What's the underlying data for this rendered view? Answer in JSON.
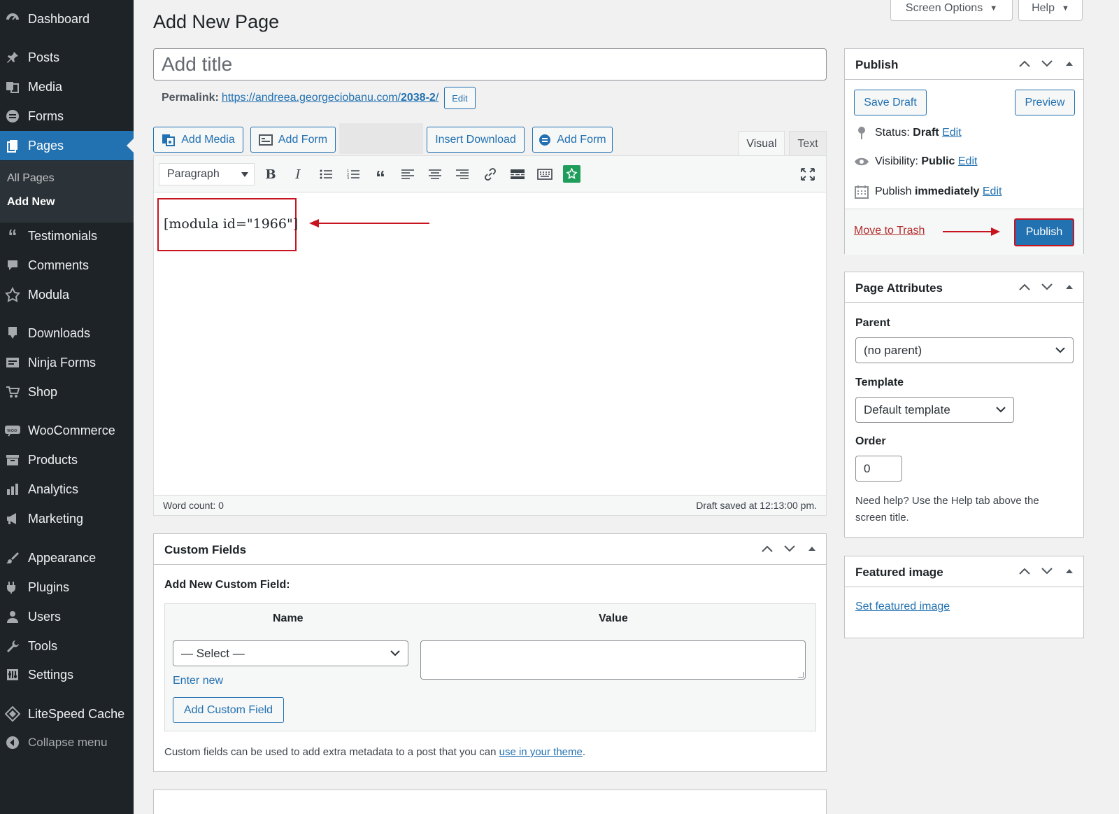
{
  "sidebar": {
    "items": [
      {
        "label": "Dashboard",
        "icon": "dashboard-icon"
      },
      {
        "label": "Posts",
        "icon": "pin-icon"
      },
      {
        "label": "Media",
        "icon": "media-icon"
      },
      {
        "label": "Forms",
        "icon": "forms-icon"
      },
      {
        "label": "Pages",
        "icon": "pages-icon"
      },
      {
        "label": "Testimonials",
        "icon": "quote-icon"
      },
      {
        "label": "Comments",
        "icon": "comment-icon"
      },
      {
        "label": "Modula",
        "icon": "modula-icon"
      },
      {
        "label": "Downloads",
        "icon": "download-icon"
      },
      {
        "label": "Ninja Forms",
        "icon": "ninja-forms-icon"
      },
      {
        "label": "Shop",
        "icon": "cart-icon"
      },
      {
        "label": "WooCommerce",
        "icon": "woo-icon"
      },
      {
        "label": "Products",
        "icon": "archive-icon"
      },
      {
        "label": "Analytics",
        "icon": "bar-chart-icon"
      },
      {
        "label": "Marketing",
        "icon": "megaphone-icon"
      },
      {
        "label": "Appearance",
        "icon": "brush-icon"
      },
      {
        "label": "Plugins",
        "icon": "plug-icon"
      },
      {
        "label": "Users",
        "icon": "user-icon"
      },
      {
        "label": "Tools",
        "icon": "wrench-icon"
      },
      {
        "label": "Settings",
        "icon": "settings-icon"
      },
      {
        "label": "LiteSpeed Cache",
        "icon": "diamond-icon"
      }
    ],
    "submenu": [
      "All Pages",
      "Add New"
    ],
    "collapse": "Collapse menu"
  },
  "top": {
    "screen_options": "Screen Options",
    "help": "Help"
  },
  "page_title": "Add New Page",
  "title_placeholder": "Add title",
  "permalink": {
    "label": "Permalink:",
    "url_base": "https://andreea.georgeciobanu.com/",
    "slug": "2038-2",
    "url_end": "/",
    "edit": "Edit"
  },
  "media_buttons": {
    "add_media": "Add Media",
    "add_form": "Add Form",
    "insert_download": "Insert Download",
    "add_form_2": "Add Form"
  },
  "editor_tabs": {
    "visual": "Visual",
    "text": "Text"
  },
  "toolbar": {
    "format": "Paragraph"
  },
  "content": "[modula id=\"1966\"]",
  "status_bar": {
    "word_count": "Word count: 0",
    "draft_saved": "Draft saved at 12:13:00 pm."
  },
  "publish": {
    "title": "Publish",
    "save_draft": "Save Draft",
    "preview": "Preview",
    "status_label": "Status:",
    "status_value": "Draft",
    "visibility_label": "Visibility:",
    "visibility_value": "Public",
    "publish_label": "Publish",
    "publish_value": "immediately",
    "edit": "Edit",
    "trash": "Move to Trash",
    "publish_button": "Publish"
  },
  "page_attributes": {
    "title": "Page Attributes",
    "parent_label": "Parent",
    "parent_value": "(no parent)",
    "template_label": "Template",
    "template_value": "Default template",
    "order_label": "Order",
    "order_value": "0",
    "help": "Need help? Use the Help tab above the screen title."
  },
  "featured_image": {
    "title": "Featured image",
    "link": "Set featured image"
  },
  "custom_fields": {
    "title": "Custom Fields",
    "add_new_label": "Add New Custom Field:",
    "name_header": "Name",
    "value_header": "Value",
    "select_value": "— Select —",
    "enter_new": "Enter new",
    "add_button": "Add Custom Field",
    "note_prefix": "Custom fields can be used to add extra metadata to a post that you can ",
    "note_link": "use in your theme",
    "note_suffix": "."
  },
  "colors": {
    "accent": "#2271b1",
    "sidebar": "#1d2327",
    "annotation": "#c8141e"
  }
}
